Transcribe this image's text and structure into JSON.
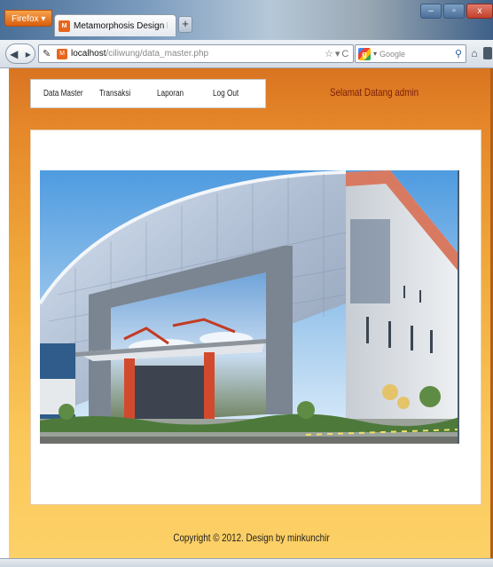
{
  "browser": {
    "menu_button": "Firefox",
    "tab_title": "Metamorphosis Design Free Css Templa...",
    "tab_favicon": "M",
    "new_tab": "+",
    "window_controls": {
      "minimize": "–",
      "maximize": "▫",
      "close": "x"
    },
    "url_host": "localhost",
    "url_path": "/ciliwung/data_master.php",
    "search_placeholder": "Google",
    "search_engine_icon": "g"
  },
  "page": {
    "menu": [
      {
        "label": "Data Master"
      },
      {
        "label": "Transaksi"
      },
      {
        "label": "Laporan"
      },
      {
        "label": "Log Out"
      }
    ],
    "welcome": "Selamat Datang admin",
    "footer": "Copyright © 2012. Design by minkunchir"
  },
  "colors": {
    "page_gradient_top": "#d97420",
    "page_gradient_bottom": "#fcd167",
    "welcome_text": "#7a1e07"
  }
}
